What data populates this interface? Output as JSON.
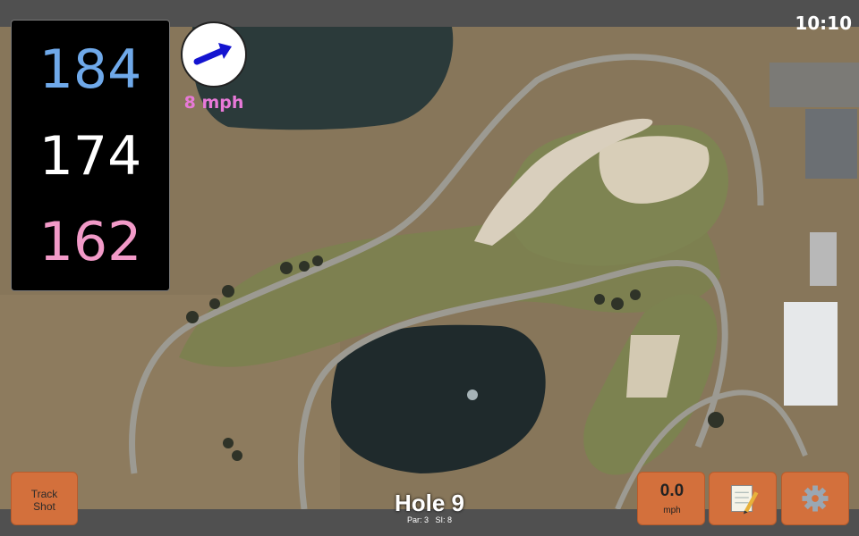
{
  "status": {
    "time": "10:10"
  },
  "distances": {
    "back": "184",
    "center": "174",
    "front": "162"
  },
  "wind": {
    "speed": "8 mph",
    "icon": "wind-direction-arrow-icon"
  },
  "buttons": {
    "track_shot": "Track Shot",
    "speed_value": "0.0",
    "speed_unit": "mph",
    "notes_icon": "notepad-icon",
    "settings_icon": "gear-icon"
  },
  "hole": {
    "title": "Hole 9",
    "par_label": "Par: 3",
    "si_label": "SI: 8"
  },
  "colors": {
    "back": "#6fa9ea",
    "center": "#ffffff",
    "front": "#f29ac8",
    "wind_text": "#e879d8",
    "button": "#d3703c"
  }
}
